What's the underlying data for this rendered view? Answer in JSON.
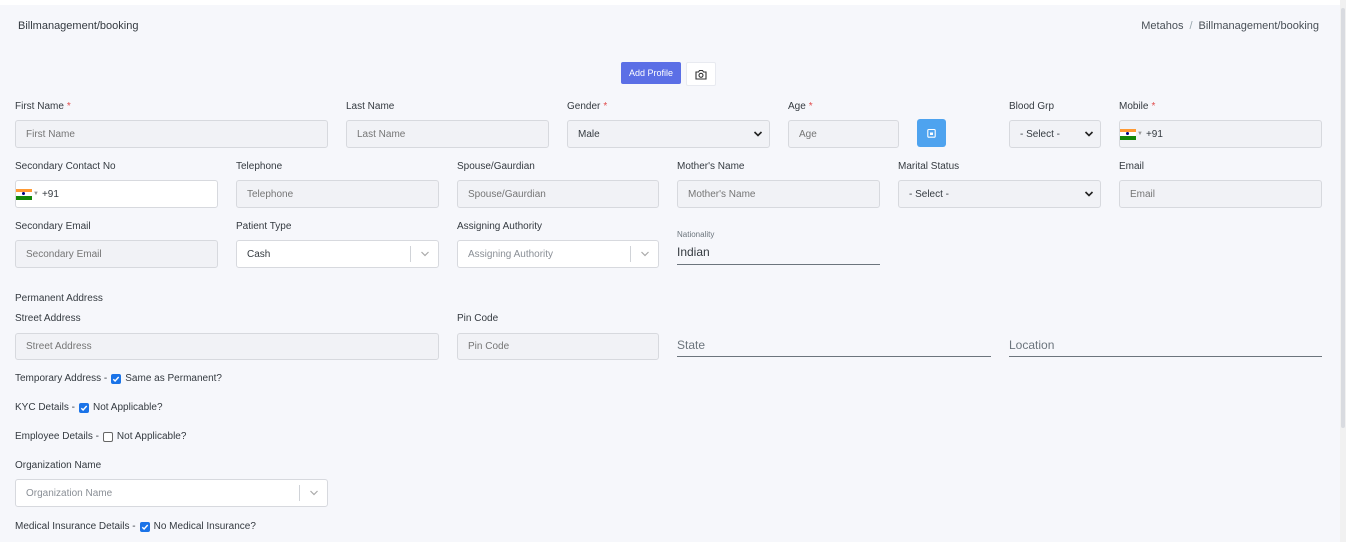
{
  "header": {
    "page_title": "Billmanagement/booking",
    "breadcrumb_root": "Metahos",
    "breadcrumb_sep": "/",
    "breadcrumb_current": "Billmanagement/booking"
  },
  "toolbar": {
    "add_profile": "Add Profile"
  },
  "form": {
    "first_name": {
      "label": "First Name",
      "req": "*",
      "placeholder": "First Name"
    },
    "last_name": {
      "label": "Last Name",
      "placeholder": "Last Name"
    },
    "gender": {
      "label": "Gender",
      "req": "*",
      "value": "Male"
    },
    "age": {
      "label": "Age",
      "req": "*",
      "placeholder": "Age"
    },
    "blood_grp": {
      "label": "Blood Grp",
      "value": "- Select -"
    },
    "mobile": {
      "label": "Mobile",
      "req": "*",
      "code": "+91"
    },
    "secondary_contact": {
      "label": "Secondary Contact No",
      "code": "+91"
    },
    "telephone": {
      "label": "Telephone",
      "placeholder": "Telephone"
    },
    "spouse": {
      "label": "Spouse/Gaurdian",
      "placeholder": "Spouse/Gaurdian"
    },
    "mother": {
      "label": "Mother's Name",
      "placeholder": "Mother's Name"
    },
    "marital": {
      "label": "Marital Status",
      "value": "- Select -"
    },
    "email": {
      "label": "Email",
      "placeholder": "Email"
    },
    "secondary_email": {
      "label": "Secondary Email",
      "placeholder": "Secondary Email"
    },
    "patient_type": {
      "label": "Patient Type",
      "value": "Cash"
    },
    "assigning_authority": {
      "label": "Assigning Authority",
      "placeholder": "Assigning Authority"
    },
    "nationality": {
      "label": "Nationality",
      "value": "Indian"
    },
    "permanent_address": {
      "section": "Permanent Address",
      "street_label": "Street Address",
      "street_placeholder": "Street Address",
      "pin_label": "Pin Code",
      "pin_placeholder": "Pin Code",
      "state": "State",
      "location": "Location"
    },
    "temporary_address": {
      "label": "Temporary Address -",
      "check_label": "Same as Permanent?",
      "checked": true
    },
    "kyc": {
      "label": "KYC Details -",
      "check_label": "Not Applicable?",
      "checked": true
    },
    "employee": {
      "label": "Employee Details -",
      "check_label": "Not Applicable?",
      "checked": false
    },
    "organization": {
      "label": "Organization Name",
      "placeholder": "Organization Name"
    },
    "insurance": {
      "label": "Medical Insurance Details -",
      "check_label": "No Medical Insurance?",
      "checked": true
    }
  },
  "colors": {
    "primary": "#5b6fe6",
    "calendar": "#4ea3ef",
    "checkbox": "#1a73e8",
    "required": "#e14b4b"
  }
}
